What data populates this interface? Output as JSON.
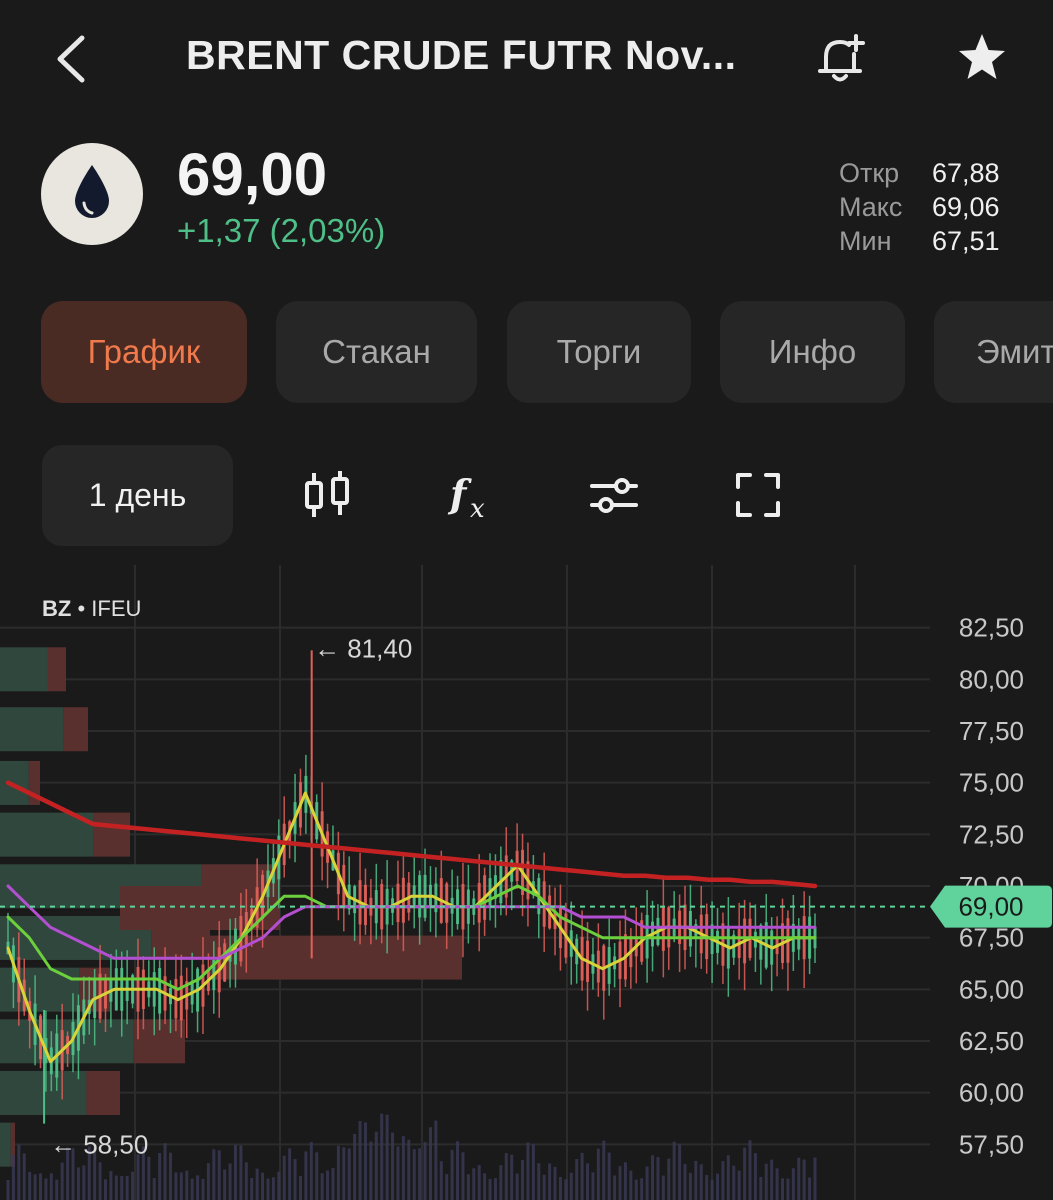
{
  "header": {
    "title": "BRENT CRUDE FUTR  Nov...",
    "back_icon": "chevron-left-icon",
    "alert_icon": "bell-plus-icon",
    "favorite_icon": "star-icon"
  },
  "instrument": {
    "logo_icon": "oil-drop-icon",
    "price": "69,00",
    "change": "+1,37 (2,03%)",
    "open_label": "Откр",
    "open_value": "67,88",
    "high_label": "Макс",
    "high_value": "69,06",
    "low_label": "Мин",
    "low_value": "67,51"
  },
  "tabs": [
    {
      "label": "График",
      "active": true
    },
    {
      "label": "Стакан",
      "active": false
    },
    {
      "label": "Торги",
      "active": false
    },
    {
      "label": "Инфо",
      "active": false
    },
    {
      "label": "Эмит",
      "active": false
    }
  ],
  "toolbar": {
    "period_label": "1 день",
    "tools": [
      "candlestick-icon",
      "function-icon",
      "settings-sliders-icon",
      "fullscreen-icon"
    ]
  },
  "chart": {
    "symbol": "BZ",
    "exchange": "IFEU",
    "price_tag": "69,00",
    "high_marker": "81,40",
    "low_marker": "58,50",
    "colors": {
      "up": "#4fbf88",
      "down": "#e0605a",
      "ma_fast": "#d9d33a",
      "ma_mid": "#6ccf3c",
      "ma_slow": "#b34fd1",
      "ma_long": "#c42222",
      "tag_bg": "#5fd39b"
    }
  },
  "chart_data": {
    "type": "candlestick",
    "y_tick_labels": [
      "82,50",
      "80,00",
      "77,50",
      "75,00",
      "72,50",
      "70,00",
      "67,50",
      "65,00",
      "62,50",
      "60,00",
      "57,50"
    ],
    "ylim": [
      56.5,
      83.5
    ],
    "last_price": 69.0,
    "series": [
      {
        "values": [
          67.0,
          64.0,
          61.5,
          62.5,
          64.5,
          65.0,
          65.0,
          65.0,
          64.5,
          65.0,
          66.0,
          67.5,
          69.5,
          72.0,
          74.5,
          72.0,
          69.5,
          69.0,
          69.0,
          69.5,
          69.5,
          69.0,
          69.0,
          70.0,
          71.0,
          69.5,
          68.0,
          66.5,
          66.0,
          66.5,
          67.5,
          68.0,
          68.0,
          67.5,
          67.0,
          67.5,
          67.0,
          67.5,
          67.5
        ]
      },
      {
        "values": [
          68.5,
          67.5,
          66.0,
          65.5,
          65.5,
          65.5,
          65.5,
          65.5,
          65.0,
          65.5,
          66.5,
          67.5,
          68.5,
          69.5,
          69.5,
          69.0,
          69.0,
          69.0,
          69.0,
          69.0,
          69.0,
          69.0,
          69.0,
          69.5,
          70.0,
          69.5,
          68.5,
          68.0,
          67.5,
          67.5,
          67.5,
          67.5,
          67.5,
          67.5,
          67.5,
          67.5,
          67.5,
          67.5,
          67.5
        ]
      },
      {
        "values": [
          70.0,
          69.0,
          68.0,
          67.5,
          67.0,
          66.5,
          66.5,
          66.5,
          66.5,
          66.5,
          66.5,
          67.0,
          67.5,
          68.5,
          69.0,
          69.0,
          69.0,
          69.0,
          69.0,
          69.0,
          69.0,
          69.0,
          69.0,
          69.0,
          69.0,
          69.0,
          69.0,
          68.5,
          68.5,
          68.5,
          68.0,
          68.0,
          68.0,
          68.0,
          68.0,
          68.0,
          68.0,
          68.0,
          68.0
        ]
      },
      {
        "values": [
          75.0,
          74.5,
          74.0,
          73.5,
          73.0,
          72.9,
          72.8,
          72.7,
          72.6,
          72.5,
          72.4,
          72.3,
          72.2,
          72.1,
          72.0,
          71.9,
          71.8,
          71.7,
          71.6,
          71.5,
          71.4,
          71.3,
          71.2,
          71.1,
          71.0,
          70.9,
          70.8,
          70.7,
          70.6,
          70.5,
          70.5,
          70.4,
          70.4,
          70.3,
          70.3,
          70.2,
          70.2,
          70.1,
          70.0
        ]
      }
    ]
  }
}
